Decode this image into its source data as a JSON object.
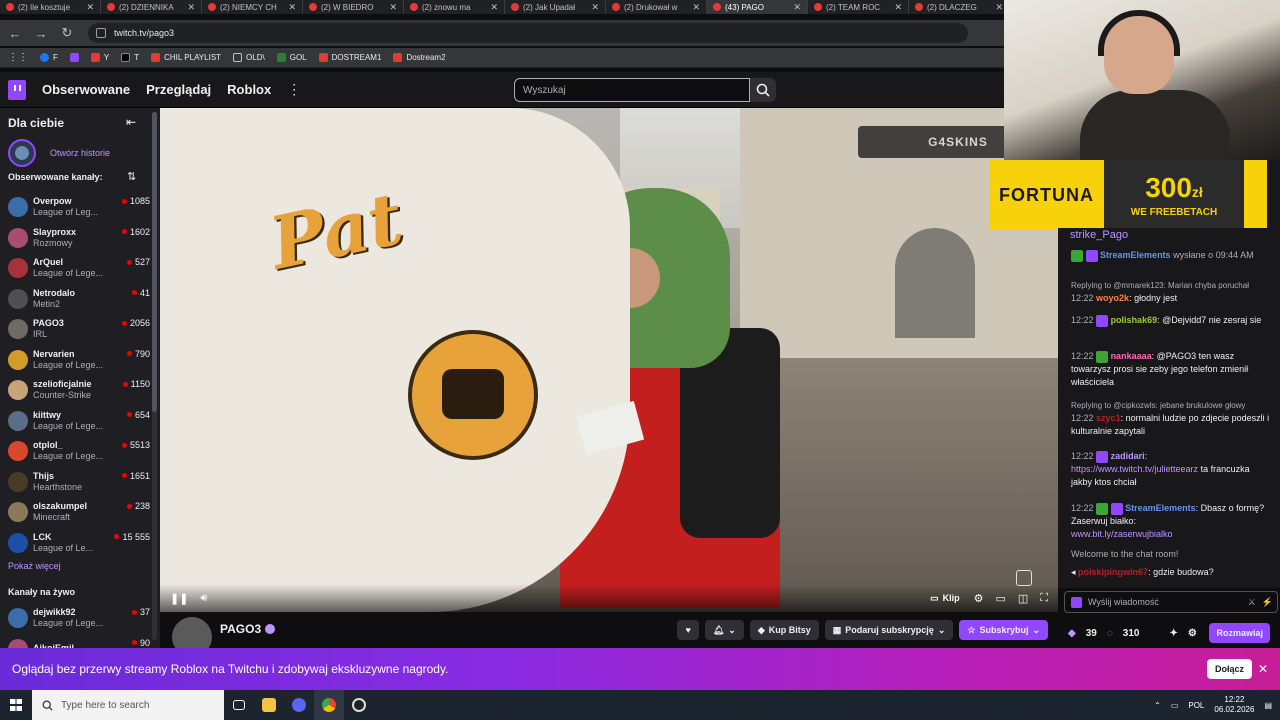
{
  "browser": {
    "tabs": [
      {
        "title": "(2) Ile kosztuje"
      },
      {
        "title": "(2) DZIENNIKA"
      },
      {
        "title": "(2) NIEMCY CH"
      },
      {
        "title": "(2) W BIEDRO"
      },
      {
        "title": "(2) znowu ma"
      },
      {
        "title": "(2) Jak Upadał"
      },
      {
        "title": "(2) Drukował w"
      },
      {
        "title": "(43) PAGO"
      },
      {
        "title": "(2) TEAM ROC"
      },
      {
        "title": "(2) DLACZEG"
      }
    ],
    "url": "twitch.tv/pago3",
    "bookmarks": [
      "F",
      "",
      "Y",
      "T",
      "CHIL PLAYLIST",
      "OLD\\",
      "GOL",
      "DOSTREAM1",
      "Dostream2"
    ]
  },
  "twitch": {
    "nav": {
      "followed": "Obserwowane",
      "browse": "Przeglądaj",
      "category": "Roblox"
    },
    "search_placeholder": "Wyszukaj"
  },
  "sidebar": {
    "title": "Dla ciebie",
    "stories": "Otwórz historie",
    "followed_header": "Obserwowane kanały:",
    "channels": [
      {
        "name": "Overpow",
        "game": "League of Leg...",
        "viewers": "1085"
      },
      {
        "name": "Slayproxx",
        "game": "Rozmowy",
        "viewers": "1602"
      },
      {
        "name": "ArQuel",
        "game": "League of Lege...",
        "viewers": "527"
      },
      {
        "name": "Netrodalo",
        "game": "Metin2",
        "viewers": "41"
      },
      {
        "name": "PAGO3",
        "game": "IRL",
        "viewers": "2056"
      },
      {
        "name": "Nervarien",
        "game": "League of Lege...",
        "viewers": "790"
      },
      {
        "name": "szelioficjalnie",
        "game": "Counter-Strike",
        "viewers": "1150"
      },
      {
        "name": "kiittwy",
        "game": "League of Lege...",
        "viewers": "654"
      },
      {
        "name": "otplol_",
        "game": "League of Lege...",
        "viewers": "5513"
      },
      {
        "name": "Thijs",
        "game": "Hearthstone",
        "viewers": "1651"
      },
      {
        "name": "olszakumpel",
        "game": "Minecraft",
        "viewers": "238"
      },
      {
        "name": "LCK",
        "game": "League of Le...",
        "viewers": "15 555"
      }
    ],
    "show_more": "Pokaż więcej",
    "live_header": "Kanały na żywo",
    "live_channels": [
      {
        "name": "dejwikk92",
        "game": "League of Lege...",
        "viewers": "37"
      },
      {
        "name": "AikoiEmil",
        "game": "",
        "viewers": "90"
      }
    ]
  },
  "video": {
    "overlay_logo": "G4SKINS",
    "clip_label": "Klip"
  },
  "sponsor": {
    "brand": "FORTUNA",
    "amount": "300",
    "currency": "zł",
    "tagline": "WE FREEBETACH"
  },
  "channel": {
    "name": "PAGO3",
    "buy_bits": "Kup Bitsy",
    "gift_sub": "Podaruj subskrypcję",
    "subscribe": "Subskrybuj"
  },
  "chat": {
    "top_user": "strike_Pago",
    "messages": [
      {
        "type": "system",
        "user": "StreamElements",
        "text": "wysłane o 09:44 AM"
      },
      {
        "type": "reply",
        "reply": "Replying to @mmarek123: Marian chyba poruchał",
        "time": "12:22",
        "user": "woyo2k",
        "text": ": głodny jest"
      },
      {
        "time": "12:22",
        "user": "polishak69",
        "text": ": @Dejvidd7 nie zesraj sie"
      },
      {
        "time": "12:22",
        "user": "nankaaaa",
        "text": ": @PAGO3 ten wasz towarzysz prosi sie zeby jego telefon zmienił właściciela"
      },
      {
        "type": "reply",
        "reply": "Replying to @cipkozwls: jebane brukulowe głowy",
        "time": "12:22",
        "user": "szyc1",
        "text": ": normalni ludzie po zdjecie podeszli i kulturalnie zapytali"
      },
      {
        "time": "12:22",
        "user": "zadidari",
        "link": "https://www.twitch.tv/julietteearz",
        "text": "ta francuzka jakby ktos chciał"
      },
      {
        "time": "12:22",
        "user": "StreamElements",
        "text": ": Dbasz o formę? Zaserwuj białko:",
        "link": "www.bit.ly/zaserwujbialko"
      },
      {
        "type": "welcome",
        "text": "Welcome to the chat room!"
      },
      {
        "user": "polskipingwin67",
        "text": ": gdzie budowa?"
      }
    ],
    "input_placeholder": "Wyślij wiadomość",
    "points": "39",
    "points2": "310",
    "chat_button": "Rozmawiaj"
  },
  "banner": {
    "text": "Oglądaj bez przerwy streamy Roblox na Twitchu i zdobywaj ekskluzywne nagrody.",
    "button": "Dołącz"
  },
  "taskbar": {
    "search_placeholder": "Type here to search",
    "lang": "POL",
    "time": "12:22",
    "date": "06.02.2026"
  }
}
